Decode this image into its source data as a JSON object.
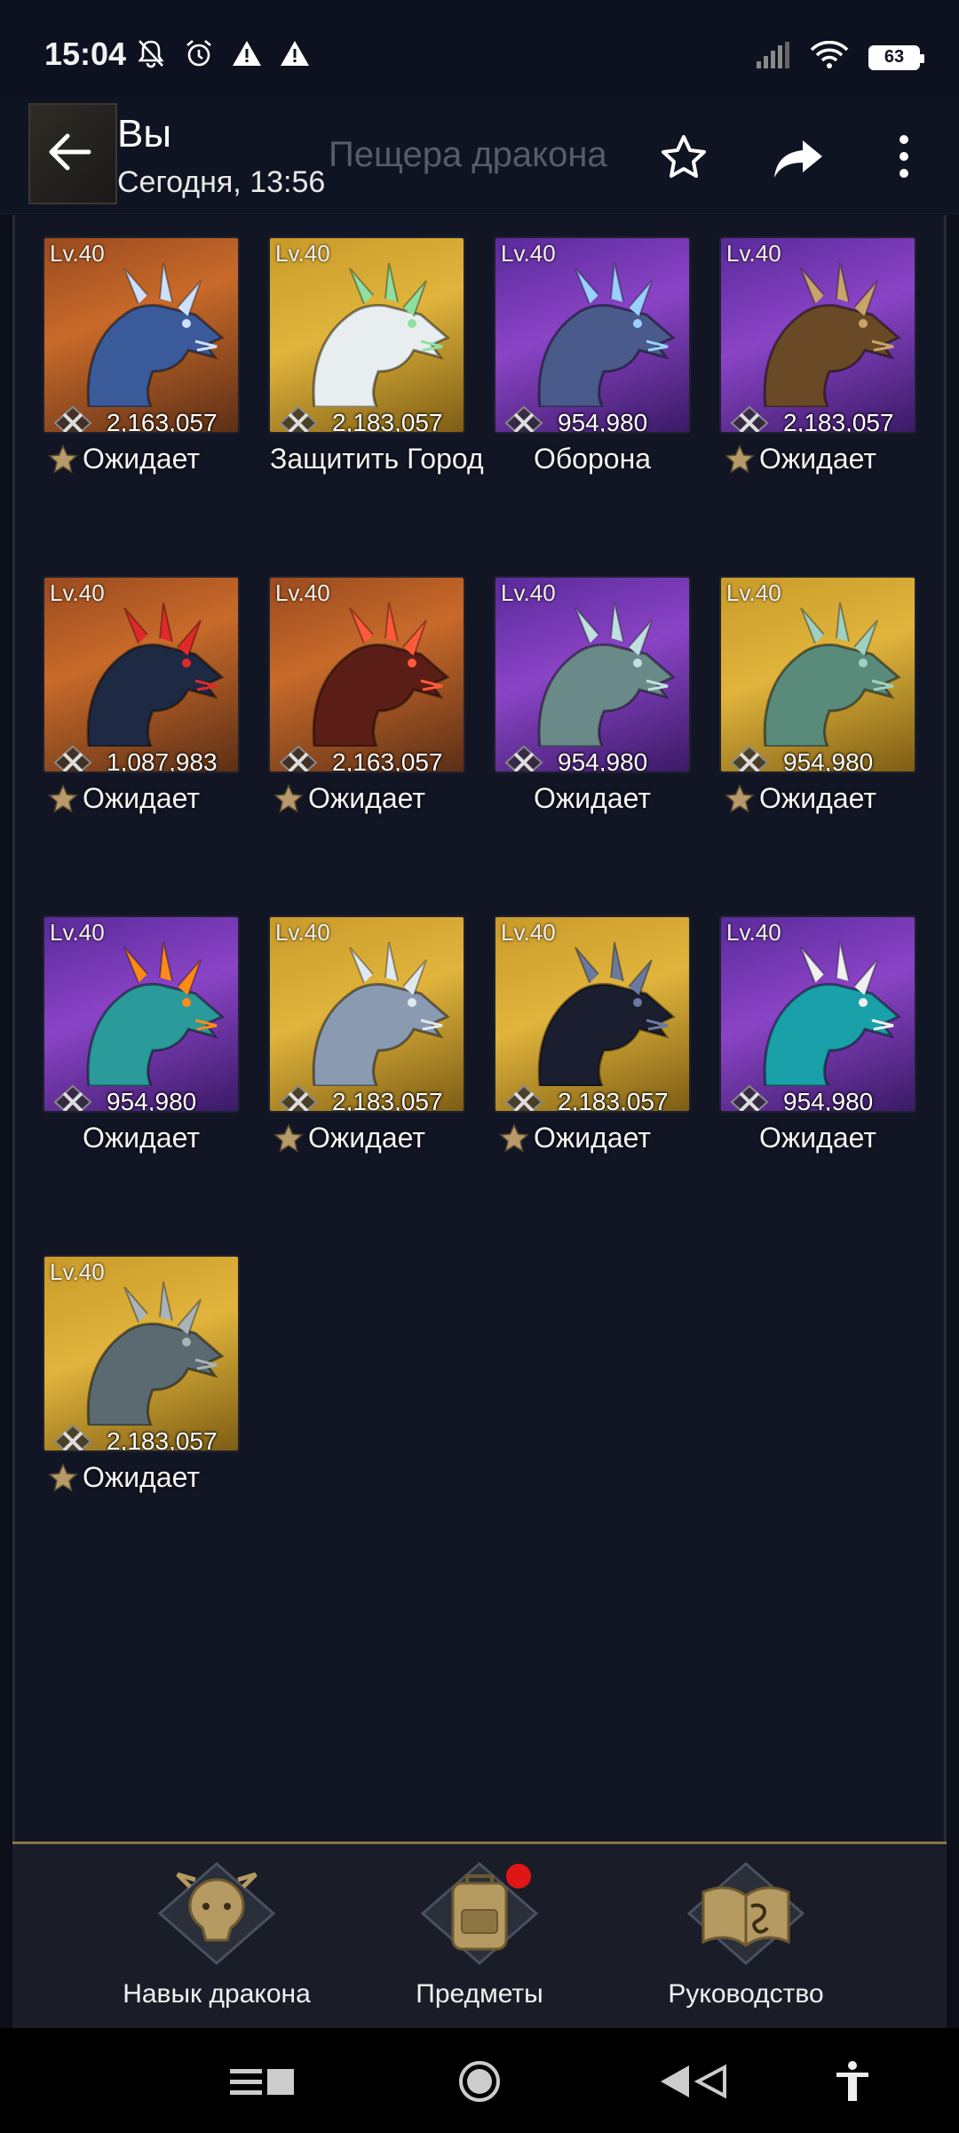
{
  "status_bar": {
    "time": "15:04",
    "battery": "63",
    "icons_left": [
      "mute-bell-icon",
      "alarm-icon",
      "warning-icon",
      "warning-icon"
    ],
    "icons_right": [
      "signal-icon",
      "wifi-icon",
      "battery-icon"
    ]
  },
  "header": {
    "title": "Вы",
    "subtitle": "Сегодня, 13:56",
    "ghost_title": "Пещера дракона"
  },
  "dragons": [
    {
      "level": "Lv.40",
      "power": "2,163,057",
      "status": "Ожидает",
      "bg": "orange",
      "body": "#3a5a9a",
      "accent": "#cfe0ff",
      "fav": true
    },
    {
      "level": "Lv.40",
      "power": "2,183,057",
      "status": "Защитить Город",
      "bg": "gold",
      "body": "#e8eef0",
      "accent": "#8fe0a0",
      "fav": false
    },
    {
      "level": "Lv.40",
      "power": "954,980",
      "status": "Оборона",
      "bg": "purple",
      "body": "#4a5a8a",
      "accent": "#9ad0ff",
      "fav": false
    },
    {
      "level": "Lv.40",
      "power": "2,183,057",
      "status": "Ожидает",
      "bg": "purple",
      "body": "#6a4a26",
      "accent": "#c9a46a",
      "fav": true
    },
    {
      "level": "Lv.40",
      "power": "1,087,983",
      "status": "Ожидает",
      "bg": "orange",
      "body": "#1e2a44",
      "accent": "#e02a2a",
      "fav": true
    },
    {
      "level": "Lv.40",
      "power": "2,163,057",
      "status": "Ожидает",
      "bg": "orange",
      "body": "#5a1e16",
      "accent": "#ff5a3a",
      "fav": true
    },
    {
      "level": "Lv.40",
      "power": "954,980",
      "status": "Ожидает",
      "bg": "purple",
      "body": "#6a8a8a",
      "accent": "#c0e0e0",
      "fav": false
    },
    {
      "level": "Lv.40",
      "power": "954,980",
      "status": "Ожидает",
      "bg": "gold",
      "body": "#5a8a7a",
      "accent": "#a0d0c0",
      "fav": true
    },
    {
      "level": "Lv.40",
      "power": "954,980",
      "status": "Ожидает",
      "bg": "purple",
      "body": "#2a9a9a",
      "accent": "#ff8a1a",
      "fav": false
    },
    {
      "level": "Lv.40",
      "power": "2,183,057",
      "status": "Ожидает",
      "bg": "gold",
      "body": "#8a9ab0",
      "accent": "#e0e8f0",
      "fav": true
    },
    {
      "level": "Lv.40",
      "power": "2,183,057",
      "status": "Ожидает",
      "bg": "gold",
      "body": "#1a1e2e",
      "accent": "#6a7aa0",
      "fav": true
    },
    {
      "level": "Lv.40",
      "power": "954,980",
      "status": "Ожидает",
      "bg": "purple",
      "body": "#1aa0a8",
      "accent": "#f0f0f0",
      "fav": false
    },
    {
      "level": "Lv.40",
      "power": "2,183,057",
      "status": "Ожидает",
      "bg": "gold",
      "body": "#5a6a70",
      "accent": "#aab4b8",
      "fav": true
    }
  ],
  "tabs": [
    {
      "label": "Навык дракона",
      "icon": "dragon-skill-icon",
      "badge": false
    },
    {
      "label": "Предметы",
      "icon": "backpack-icon",
      "badge": true
    },
    {
      "label": "Руководство",
      "icon": "guide-book-icon",
      "badge": false
    }
  ],
  "nav": [
    "recents-icon",
    "home-icon",
    "back-icon",
    "accessibility-icon"
  ]
}
